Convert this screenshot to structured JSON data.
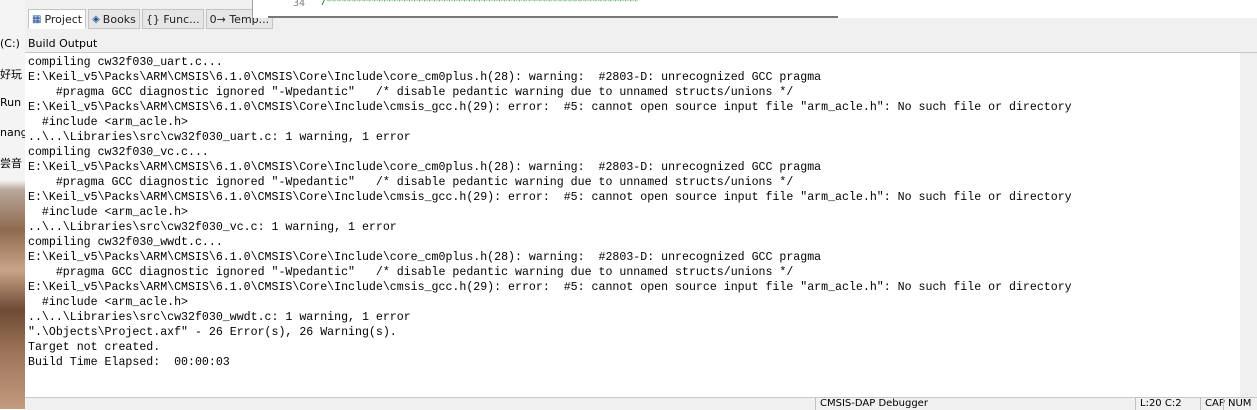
{
  "left_strip": {
    "fragments": [
      "(C:)",
      "好玩",
      "Run (",
      "nange",
      "尝音"
    ]
  },
  "project_tabs": [
    {
      "label": "Project",
      "icon": "project-icon"
    },
    {
      "label": "Books",
      "icon": "books-icon"
    },
    {
      "label": "{} Func...",
      "icon": "functions-icon"
    },
    {
      "label": "0→ Temp...",
      "icon": "templates-icon"
    }
  ],
  "editor": {
    "line_number": "34",
    "comment": "/**************************************************************"
  },
  "build_output": {
    "title": "Build Output",
    "lines": [
      "compiling cw32f030_uart.c...",
      "E:\\Keil_v5\\Packs\\ARM\\CMSIS\\6.1.0\\CMSIS\\Core\\Include\\core_cm0plus.h(28): warning:  #2803-D: unrecognized GCC pragma",
      "    #pragma GCC diagnostic ignored \"-Wpedantic\"   /* disable pedantic warning due to unnamed structs/unions */",
      "E:\\Keil_v5\\Packs\\ARM\\CMSIS\\6.1.0\\CMSIS\\Core\\Include\\cmsis_gcc.h(29): error:  #5: cannot open source input file \"arm_acle.h\": No such file or directory",
      "  #include <arm_acle.h>",
      "..\\..\\Libraries\\src\\cw32f030_uart.c: 1 warning, 1 error",
      "compiling cw32f030_vc.c...",
      "E:\\Keil_v5\\Packs\\ARM\\CMSIS\\6.1.0\\CMSIS\\Core\\Include\\core_cm0plus.h(28): warning:  #2803-D: unrecognized GCC pragma",
      "    #pragma GCC diagnostic ignored \"-Wpedantic\"   /* disable pedantic warning due to unnamed structs/unions */",
      "E:\\Keil_v5\\Packs\\ARM\\CMSIS\\6.1.0\\CMSIS\\Core\\Include\\cmsis_gcc.h(29): error:  #5: cannot open source input file \"arm_acle.h\": No such file or directory",
      "  #include <arm_acle.h>",
      "..\\..\\Libraries\\src\\cw32f030_vc.c: 1 warning, 1 error",
      "compiling cw32f030_wwdt.c...",
      "E:\\Keil_v5\\Packs\\ARM\\CMSIS\\6.1.0\\CMSIS\\Core\\Include\\core_cm0plus.h(28): warning:  #2803-D: unrecognized GCC pragma",
      "    #pragma GCC diagnostic ignored \"-Wpedantic\"   /* disable pedantic warning due to unnamed structs/unions */",
      "E:\\Keil_v5\\Packs\\ARM\\CMSIS\\6.1.0\\CMSIS\\Core\\Include\\cmsis_gcc.h(29): error:  #5: cannot open source input file \"arm_acle.h\": No such file or directory",
      "  #include <arm_acle.h>",
      "..\\..\\Libraries\\src\\cw32f030_wwdt.c: 1 warning, 1 error",
      "\".\\Objects\\Project.axf\" - 26 Error(s), 26 Warning(s).",
      "Target not created.",
      "Build Time Elapsed:  00:00:03"
    ]
  },
  "status_bar": {
    "debugger": "CMSIS-DAP Debugger",
    "position": "L:20 C:2",
    "cap": "CAP",
    "num": "NUM"
  }
}
